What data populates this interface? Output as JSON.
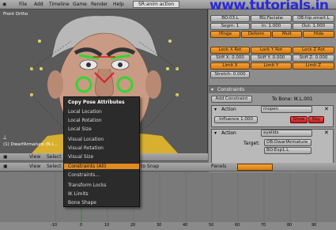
{
  "topbar": {
    "menus": [
      "File",
      "Add",
      "Timeline",
      "Game",
      "Render",
      "Help"
    ],
    "screen": "SR:anim action",
    "watermark": "www.tutorials.in"
  },
  "viewport": {
    "label": "Front Ortho",
    "object_label": "(1) DwarfArmature (N.L...",
    "footer": [
      "View",
      "Select"
    ]
  },
  "panel": {
    "row1": [
      "BO:03.L",
      "BG:Facialw",
      "OB:hip.smart.L"
    ],
    "row2": [
      "Segm: 1",
      "In: 1.000",
      "Out: 1.000"
    ],
    "row3": [
      "Hinge",
      "Deform",
      "Mult",
      "Hide"
    ],
    "row4": [
      "Lock X Rot",
      "Lock Y Rot",
      "Lock Z Rot"
    ],
    "row5": [
      "Stiff X: 0.000",
      "Stiff Y: 0.000",
      "Stiff Z: 0.000"
    ],
    "row6": [
      "Limit X",
      "Limit Y",
      "Limit Z"
    ],
    "stretch": "Stretch: 0.000",
    "constraints_title": "Constraints",
    "add_constraint": "Add Constraint",
    "to_bone": "To Bone: IK.L.001",
    "c1": {
      "type": "Action",
      "name": "mopen",
      "influence": "Influence 1.000",
      "show": "Show",
      "key": "Key"
    },
    "c2": {
      "type": "Action",
      "name": "eyelids",
      "target_label": "Target:",
      "target1": "OB:DwarfArmature",
      "target2": "BO:Exp1.L"
    }
  },
  "menu": {
    "title": "Copy Pose Attributes",
    "items": [
      "Local Location",
      "Local Rotation",
      "Local Size",
      "Visual Location",
      "Visual Rotation",
      "Visual Size",
      "Constraints (All)",
      "Constraints...",
      "Transform Locks",
      "IK Limits",
      "Bone Shape"
    ]
  },
  "timeline_header": {
    "items": [
      "View",
      "Select",
      "Panels",
      "to Snap"
    ]
  },
  "timeline": {
    "ticks": [
      "-10",
      "0",
      "10",
      "20",
      "30",
      "40",
      "50",
      "60",
      "70",
      "80",
      "90",
      "100"
    ]
  }
}
